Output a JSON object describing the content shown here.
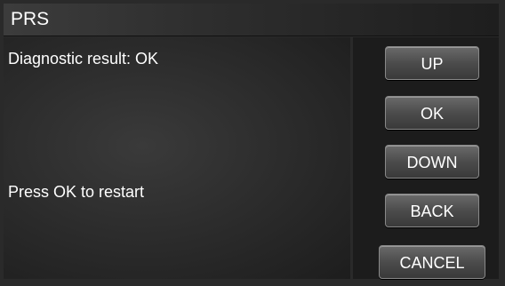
{
  "window": {
    "title": "PRS"
  },
  "content": {
    "diagnostic_result": "Diagnostic result: OK",
    "instruction": "Press OK to restart"
  },
  "buttons": {
    "up": "UP",
    "ok": "OK",
    "down": "DOWN",
    "back": "BACK",
    "cancel": "CANCEL"
  },
  "colors": {
    "background": "#2a2a2a",
    "text": "#ffffff",
    "button": "#4c4c4c"
  }
}
